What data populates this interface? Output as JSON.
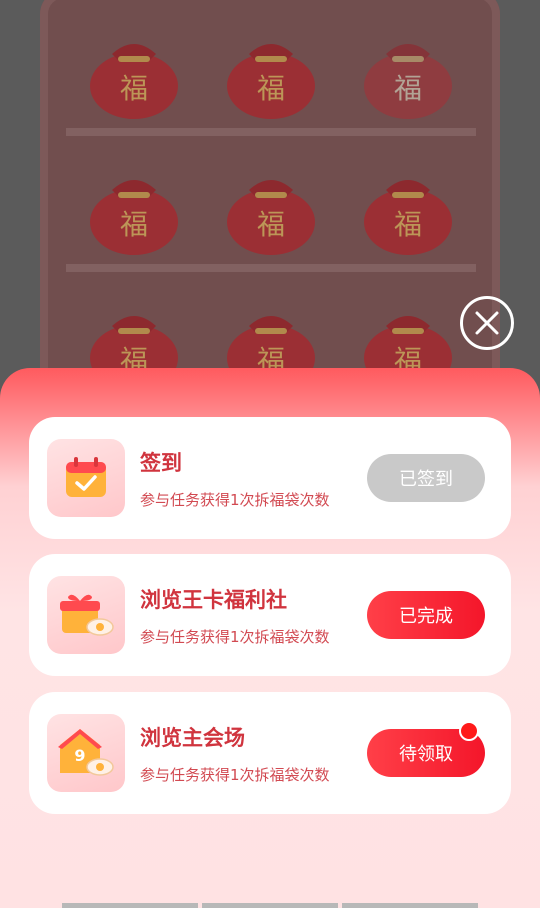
{
  "background": {
    "bag_char": "福",
    "bag_count": 9
  },
  "close": {
    "icon": "close-icon"
  },
  "tasks": [
    {
      "title": "签到",
      "desc": "参与任务获得1次拆福袋次数",
      "button": "已签到",
      "state": "done",
      "icon": "calendar-check-icon"
    },
    {
      "title": "浏览王卡福利社",
      "desc": "参与任务获得1次拆福袋次数",
      "button": "已完成",
      "state": "completed",
      "icon": "gift-eye-icon"
    },
    {
      "title": "浏览主会场",
      "desc": "参与任务获得1次拆福袋次数",
      "button": "待领取",
      "state": "claimable",
      "icon": "home-eye-icon",
      "icon_number": "9"
    }
  ],
  "colors": {
    "accent": "#f4162a",
    "title": "#d0343e",
    "disabled": "#c9c9c9"
  }
}
